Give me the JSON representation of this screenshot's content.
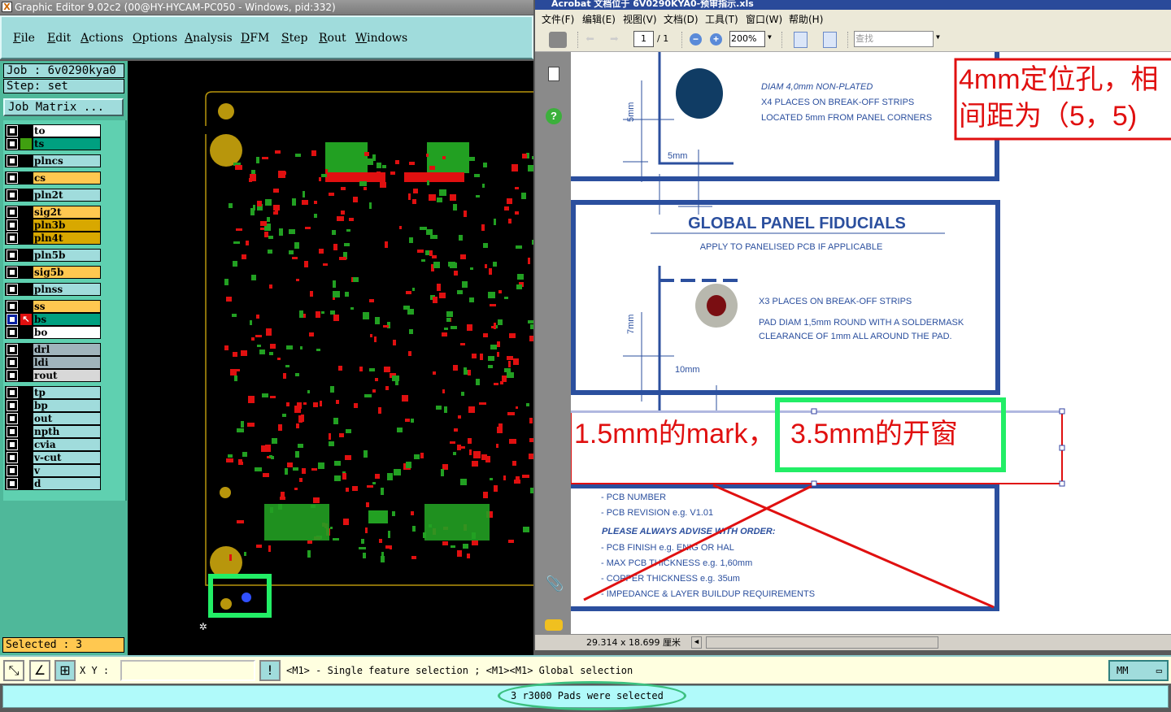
{
  "editor": {
    "title": "Graphic Editor 9.02c2 (00@HY-HYCAM-PC050 - Windows, pid:332)",
    "menu": [
      "File",
      "Edit",
      "Actions",
      "Options",
      "Analysis",
      "DFM",
      "Step",
      "Rout",
      "Windows"
    ],
    "job": "Job :  6v0290kya0",
    "step": "Step:  set",
    "job_matrix_button": "Job Matrix ...",
    "layers": [
      {
        "name": "to",
        "color": "#ffffff"
      },
      {
        "name": "ts",
        "color": "#00a080"
      },
      {
        "name": "plncs",
        "color": "#a0dcdc"
      },
      {
        "name": "cs",
        "color": "#ffc850"
      },
      {
        "name": "pln2t",
        "color": "#a0dcdc"
      },
      {
        "name": "sig2t",
        "color": "#ffc850"
      },
      {
        "name": "pln3b",
        "color": "#d8a800"
      },
      {
        "name": "pln4t",
        "color": "#d8a800"
      },
      {
        "name": "pln5b",
        "color": "#a0dcdc"
      },
      {
        "name": "sig5b",
        "color": "#ffc850"
      },
      {
        "name": "plnss",
        "color": "#a0dcdc"
      },
      {
        "name": "ss",
        "color": "#ffc850"
      },
      {
        "name": "bs",
        "color": "#00a080",
        "active": true
      },
      {
        "name": "bo",
        "color": "#ffffff"
      },
      {
        "name": "drl",
        "color": "#a0b4bc"
      },
      {
        "name": "ldi",
        "color": "#a0b4bc"
      },
      {
        "name": "rout",
        "color": "#d8d8d8"
      },
      {
        "name": "tp",
        "color": "#a0dcdc"
      },
      {
        "name": "bp",
        "color": "#a0dcdc"
      },
      {
        "name": "out",
        "color": "#a0dcdc"
      },
      {
        "name": "npth",
        "color": "#a0dcdc"
      },
      {
        "name": "cvia",
        "color": "#a0dcdc"
      },
      {
        "name": "v-cut",
        "color": "#a0dcdc"
      },
      {
        "name": "v",
        "color": "#a0dcdc"
      },
      {
        "name": "d",
        "color": "#a0dcdc"
      }
    ],
    "selected": "Selected : 3",
    "xy_label": "X Y :",
    "xy_value": "",
    "hint": "<M1> - Single feature selection ; <M1><M1> Global selection",
    "units": "MM",
    "status": "3 r3000 Pads were selected",
    "colors": {
      "pad_green": "#22a022",
      "pad_red": "#e01010",
      "profile": "#b8960c",
      "highlight": "#22ee66",
      "selected_pad": "#3050ff"
    }
  },
  "acrobat": {
    "title": "Acrobat 文档位于 6V0290KYA0-预审指示.xls",
    "menu": [
      "文件(F)",
      "编辑(E)",
      "视图(V)",
      "文档(D)",
      "工具(T)",
      "窗口(W)",
      "帮助(H)"
    ],
    "page": "1",
    "page_total": "/ 1",
    "zoom": "200%",
    "find_placeholder": "查找",
    "page_size": "29.314 x 18.699 厘米",
    "doc": {
      "hole_dim_v": "5mm",
      "hole_dim_h": "5mm",
      "hole_lines": [
        "DIAM 4,0mm   NON-PLATED",
        "X4 PLACES ON BREAK-OFF STRIPS",
        "LOCATED 5mm FROM PANEL CORNERS"
      ],
      "fid_title": "GLOBAL PANEL FIDUCIALS",
      "fid_subtitle": "APPLY TO PANELISED PCB IF APPLICABLE",
      "fid_dim_v": "7mm",
      "fid_dim_h": "10mm",
      "fid_lines": [
        "X3 PLACES ON BREAK-OFF STRIPS",
        "PAD DIAM 1,5mm ROUND WITH A SOLDERMASK",
        "CLEARANCE OF 1mm ALL AROUND THE PAD."
      ],
      "list1": [
        "- PCB NUMBER",
        "- PCB REVISION  e.g. V1.01"
      ],
      "advise": "PLEASE ALWAYS ADVISE WITH ORDER:",
      "list2": [
        "- PCB FINISH  e.g. ENIG OR HAL",
        "- MAX PCB THICKNESS  e.g. 1,60mm",
        "- COPPER THICKNESS  e.g. 35um",
        "- IMPEDANCE & LAYER BUILDUP REQUIREMENTS"
      ],
      "note_hole": [
        "4mm定位孔，相",
        "间距为（5，5)"
      ],
      "note_mark": "1.5mm的mark，",
      "note_window": "3.5mm的开窗"
    }
  }
}
